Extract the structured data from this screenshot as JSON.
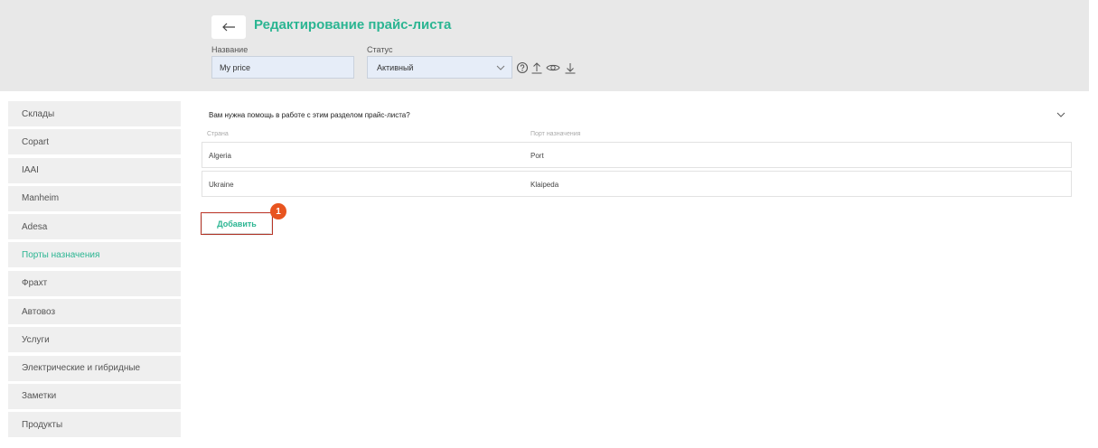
{
  "header": {
    "back_icon": "arrow-left-icon",
    "title": "Редактирование прайс-листа",
    "name_label": "Название",
    "name_value": "My price",
    "status_label": "Статус",
    "status_value": "Активный",
    "icons": [
      "help-icon",
      "upload-icon",
      "eye-icon",
      "download-icon"
    ],
    "accent_color": "#2bb592"
  },
  "sidebar": {
    "items": [
      {
        "label": "Склады"
      },
      {
        "label": "Copart"
      },
      {
        "label": "IAAI"
      },
      {
        "label": "Manheim"
      },
      {
        "label": "Adesa"
      },
      {
        "label": "Порты назначения",
        "active": true
      },
      {
        "label": "Фрахт"
      },
      {
        "label": "Автовоз"
      },
      {
        "label": "Услуги"
      },
      {
        "label": "Электрические и гибридные"
      },
      {
        "label": "Заметки"
      },
      {
        "label": "Продукты"
      }
    ]
  },
  "main": {
    "help_text": "Вам нужна помощь в работе с этим разделом прайс-листа?",
    "columns": [
      "Страна",
      "Порт назначения"
    ],
    "rows": [
      {
        "country": "Algeria",
        "port": "Port"
      },
      {
        "country": "Ukraine",
        "port": "Klaipeda"
      }
    ],
    "add_label": "Добавить",
    "badge": "1"
  }
}
